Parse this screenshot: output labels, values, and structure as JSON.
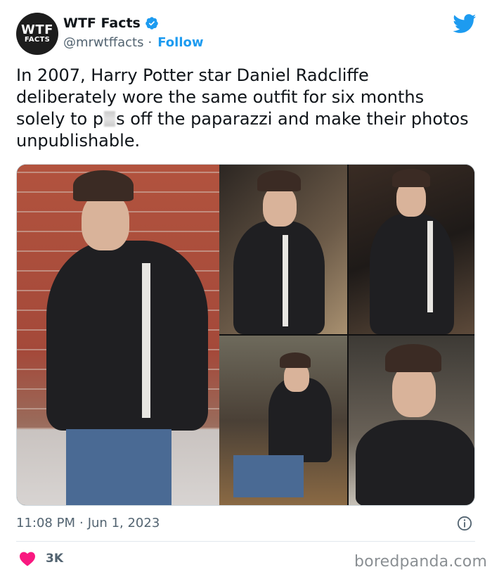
{
  "account": {
    "avatar_line1": "WTF",
    "avatar_line2": "FACTS",
    "display_name": "WTF Facts",
    "handle": "@mrwtffacts",
    "separator": "·",
    "follow_label": "Follow"
  },
  "tweet": {
    "text_before": "In 2007, Harry Potter star Daniel Radcliffe deliberately wore the same outfit for six months solely to p",
    "text_after": "s off the paparazzi and make their photos unpublishable.",
    "timestamp_time": "11:08 PM",
    "timestamp_sep": "·",
    "timestamp_date": "Jun 1, 2023",
    "like_count": "3K"
  },
  "media": {
    "photo_count": 5
  },
  "watermark": "boredpanda.com",
  "colors": {
    "accent": "#1d9bf0",
    "like": "#f91880",
    "muted": "#536471"
  },
  "icons": [
    "verified-badge-icon",
    "twitter-bird-icon",
    "info-icon",
    "heart-icon"
  ]
}
